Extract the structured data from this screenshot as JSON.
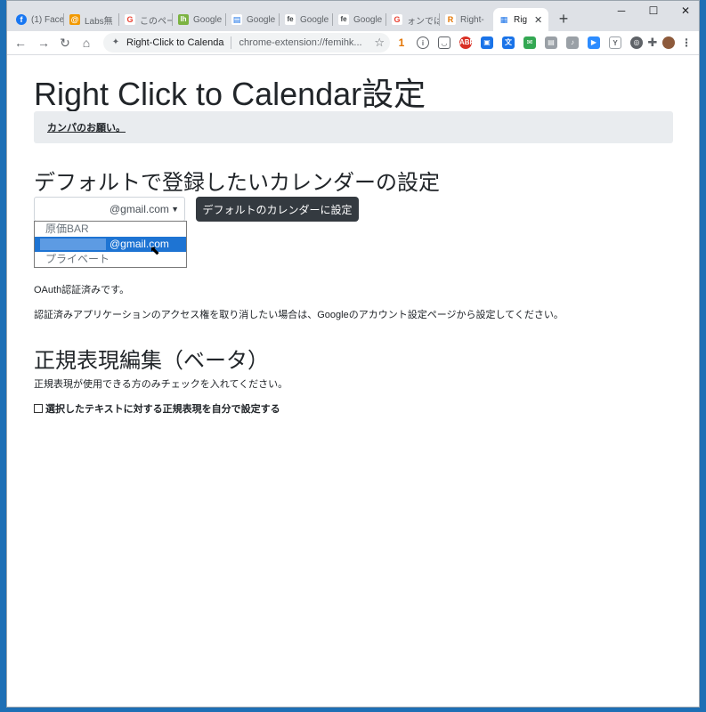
{
  "browser": {
    "tabs": [
      {
        "label": "(1) Face",
        "favicon": "facebook-icon",
        "color": "#1877f2",
        "glyph": "f"
      },
      {
        "label": "Labs無",
        "favicon": "labs-icon",
        "color": "#f29900",
        "glyph": "@"
      },
      {
        "label": "このペー",
        "favicon": "google-icon",
        "color": "#ea4335",
        "glyph": "G"
      },
      {
        "label": "Google",
        "favicon": "sheets-icon",
        "color": "#7cb342",
        "glyph": "lh"
      },
      {
        "label": "Google",
        "favicon": "slides-icon",
        "color": "#1a73e8",
        "glyph": "▤"
      },
      {
        "label": "Google",
        "favicon": "fe-icon",
        "color": "#3c4043",
        "glyph": "fe"
      },
      {
        "label": "Google",
        "favicon": "fe-icon",
        "color": "#3c4043",
        "glyph": "fe"
      },
      {
        "label": "ォンでは",
        "favicon": "google-icon",
        "color": "#ea4335",
        "glyph": "G"
      },
      {
        "label": "Right-",
        "favicon": "right-click-icon",
        "color": "#e37400",
        "glyph": "R"
      },
      {
        "label": "Rig",
        "favicon": "calendar-icon",
        "color": "#1a73e8",
        "glyph": "▦",
        "active": true
      }
    ],
    "newtab_glyph": "+",
    "window_controls": {
      "minimize": "─",
      "maximize": "☐",
      "close": "✕"
    },
    "tab_close_glyph": "✕",
    "omnibox": {
      "site_label": "Right-Click to Calenda",
      "url": "chrome-extension://femihk..."
    },
    "nav": {
      "back": "←",
      "forward": "→",
      "reload": "↻",
      "home": "⌂",
      "star": "☆"
    },
    "extension_badge": "1"
  },
  "page": {
    "title": "Right Click to Calendar設定",
    "alert_link": "カンパのお願い。",
    "default_calendar": {
      "heading": "デフォルトで登録したいカレンダーの設定",
      "select_value": "@gmail.com",
      "button_label": "デフォルトのカレンダーに設定",
      "options": [
        {
          "label": "原価BAR",
          "selected": false
        },
        {
          "label": "@gmail.com",
          "selected": true
        },
        {
          "label": "プライベート",
          "selected": false
        }
      ]
    },
    "oauth_status": "OAuth認証済みです。",
    "revoke_note": "認証済みアプリケーションのアクセス権を取り消したい場合は、Googleのアカウント設定ページから設定してください。",
    "regex": {
      "heading": "正規表現編集（ベータ）",
      "note": "正規表現が使用できる方のみチェックを入れてください。",
      "checkbox_label": "選択したテキストに対する正規表現を自分で設定する",
      "checked": false
    }
  }
}
